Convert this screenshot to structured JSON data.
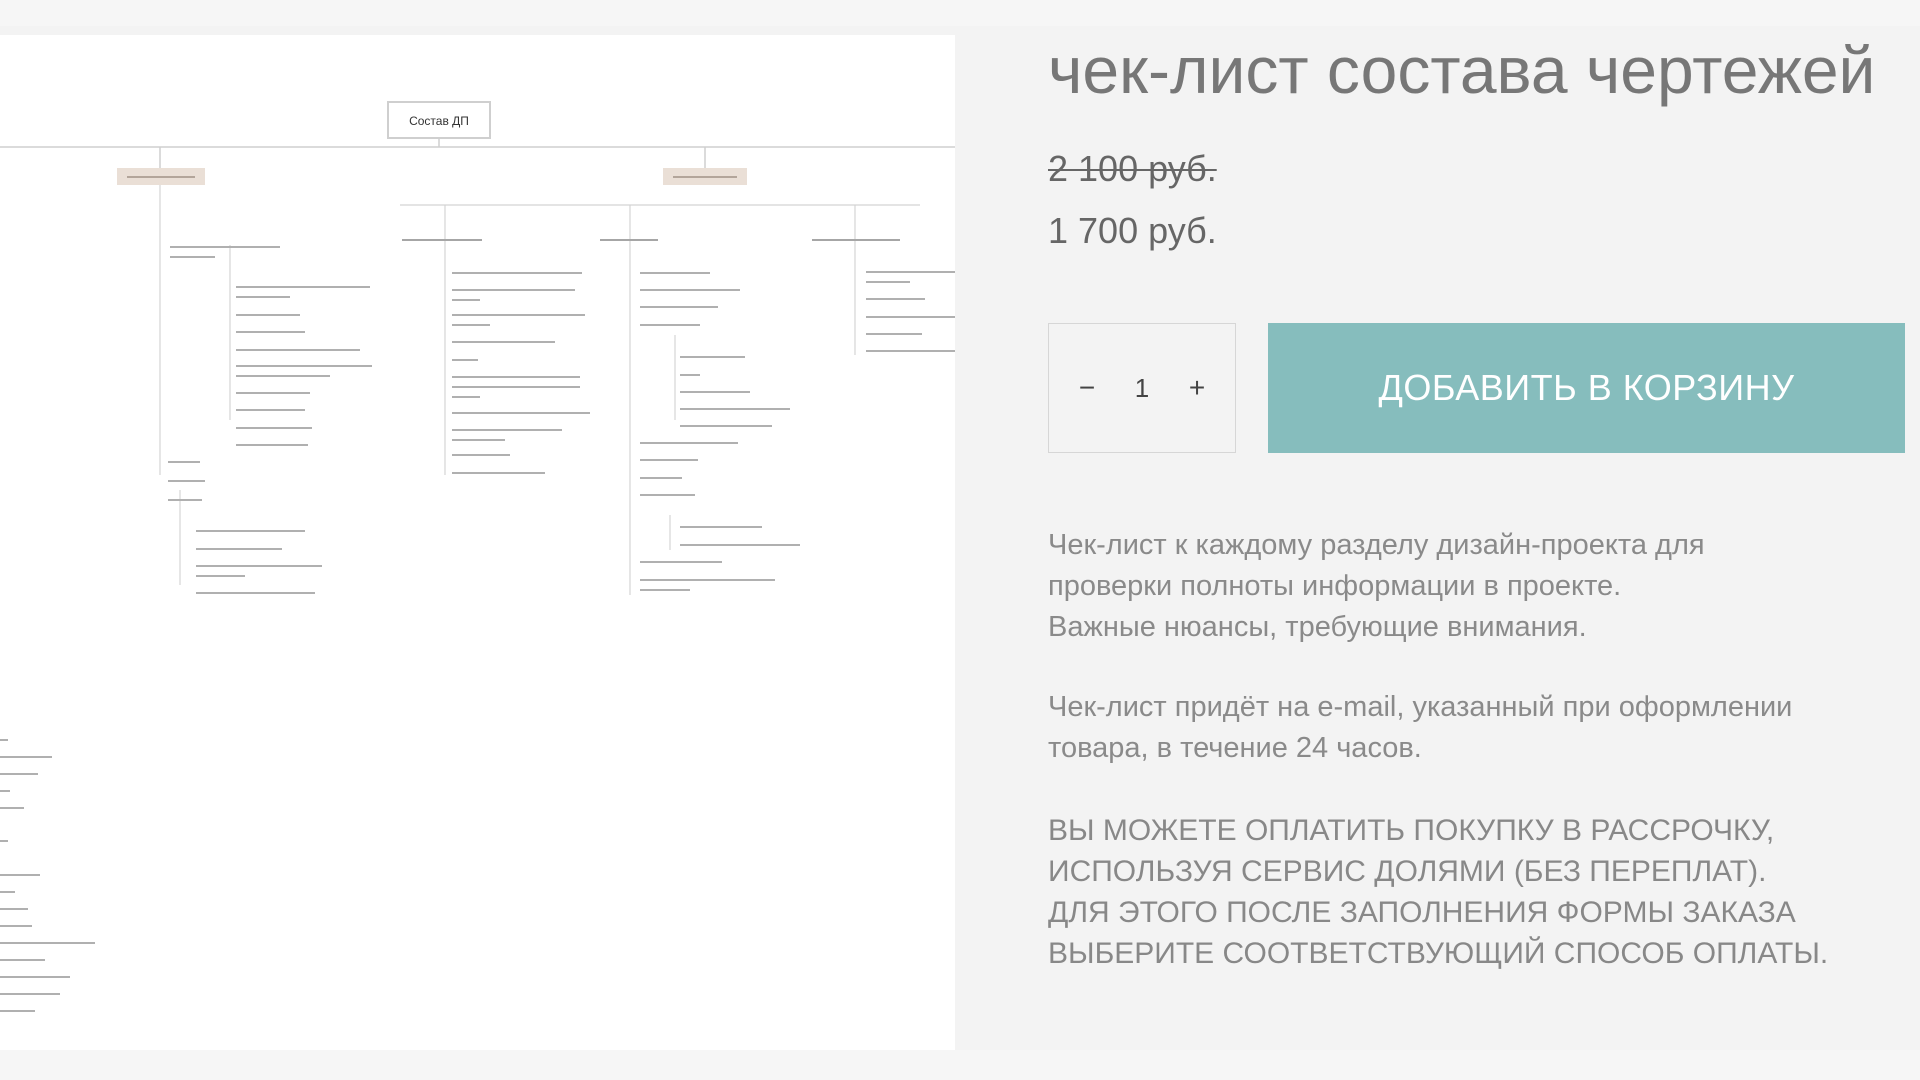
{
  "product": {
    "title": "чек-лист состава чертежей",
    "price_old": "2 100 руб.",
    "price_new": "1 700 руб."
  },
  "quantity": {
    "minus_label": "−",
    "value": "1",
    "plus_label": "+"
  },
  "cart": {
    "add_label": "ДОБАВИТЬ В КОРЗИНУ"
  },
  "description": {
    "p1_line1": "Чек-лист к каждому разделу дизайн-проекта для",
    "p1_line2": "проверки полноты информации в проекте.",
    "p1_line3": "Важные нюансы, требующие внимания.",
    "p2_line1": "Чек-лист придёт на e-mail, указанный при оформлении",
    "p2_line2": "товара, в течение 24 часов.",
    "p3_line1": "ВЫ МОЖЕТЕ ОПЛАТИТЬ ПОКУПКУ В РАССРОЧКУ,",
    "p3_line2": "ИСПОЛЬЗУЯ СЕРВИС ДОЛЯМИ (БЕЗ ПЕРЕПЛАТ).",
    "p3_line3": "ДЛЯ ЭТОГО ПОСЛЕ ЗАПОЛНЕНИЯ ФОРМЫ ЗАКАЗА",
    "p3_line4": "ВЫБЕРИТЕ СООТВЕТСТВУЮЩИЙ СПОСОБ ОПЛАТЫ."
  },
  "preview": {
    "root_label": "Состав ДП"
  },
  "colors": {
    "accent": "#86bdbd",
    "text": "#777777",
    "muted": "#8a8a8a",
    "node_fill": "#eadfd6"
  }
}
